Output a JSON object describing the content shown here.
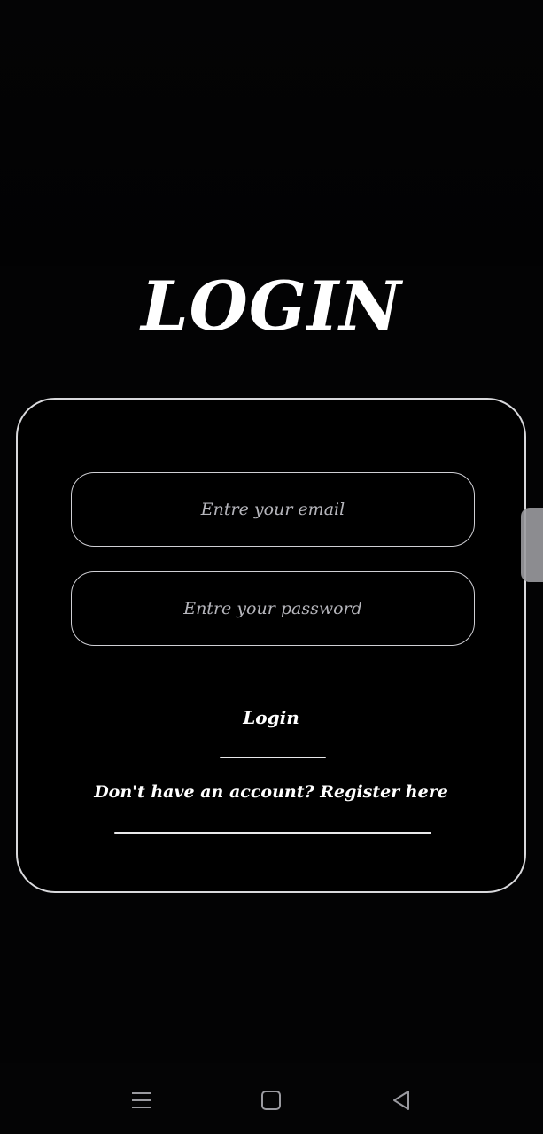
{
  "page": {
    "title": "LOGIN"
  },
  "form": {
    "email_placeholder": "Entre your email",
    "password_placeholder": "Entre your password",
    "login_label": "Login",
    "register_label": "Don't have an account?  Register here"
  },
  "nav": {
    "icons": [
      "menu-icon",
      "home-icon",
      "back-icon"
    ]
  },
  "colors": {
    "background": "#030304",
    "text": "#ffffff",
    "border": "#d9d9dc"
  }
}
